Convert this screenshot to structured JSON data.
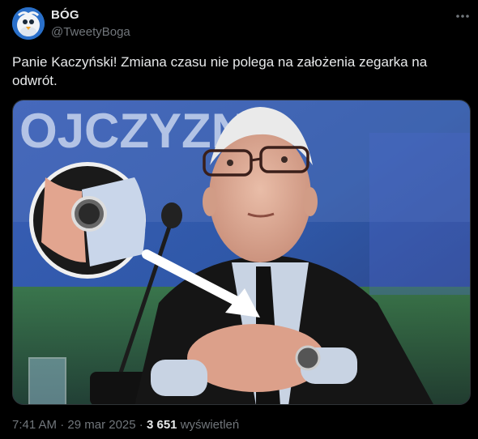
{
  "author": {
    "display_name": "BÓG",
    "handle": "@TweetyBoga",
    "avatar": "cartoon-bird-avatar"
  },
  "tweet": {
    "text": "Panie Kaczyński! Zmiana czasu nie polega na założenia zegarka na odwrót."
  },
  "media": {
    "background_text": "OJCZYZNA",
    "description_icons": [
      "man-portrait",
      "wristwatch-zoom-circle",
      "arrow-pointer"
    ]
  },
  "meta": {
    "time": "7:41 AM",
    "separator": "·",
    "date": "29 mar 2025",
    "views_count": "3 651",
    "views_label": "wyświetleń"
  },
  "icons": {
    "more": "more-dots-icon"
  },
  "colors": {
    "background": "#000000",
    "text_primary": "#e7e9ea",
    "text_secondary": "#71767b",
    "border": "#2f3336"
  }
}
